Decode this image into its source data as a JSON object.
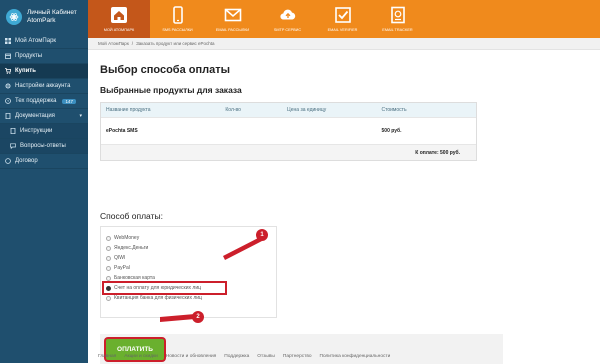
{
  "brand": {
    "line1": "Личный Кабинет",
    "line2": "AtomPark",
    "icon": "atom-icon"
  },
  "sidebar": {
    "items": [
      {
        "label": "Мой АтомПарк",
        "icon": "grid-icon"
      },
      {
        "label": "Продукты",
        "icon": "box-icon"
      },
      {
        "label": "Купить",
        "icon": "cart-icon",
        "active": true
      },
      {
        "label": "Настройки аккаунта",
        "icon": "gear-icon"
      },
      {
        "label": "Тех поддержка",
        "icon": "support-icon",
        "badge": "147"
      },
      {
        "label": "Документация",
        "icon": "doc-icon",
        "caret": "▾"
      },
      {
        "label": "Инструкции",
        "icon": "doc-icon",
        "sub": true
      },
      {
        "label": "Вопросы-ответы",
        "icon": "chat-icon",
        "sub": true
      },
      {
        "label": "Договор",
        "icon": "contract-icon"
      }
    ]
  },
  "topnav": [
    {
      "label": "Мой АтомПарк",
      "icon": "home-icon",
      "active": true
    },
    {
      "label": "SMS рассылки",
      "icon": "phone-icon"
    },
    {
      "label": "Email рассылки",
      "icon": "mail-icon"
    },
    {
      "label": "SMTP сервис",
      "icon": "cloud-upload-icon"
    },
    {
      "label": "Email verifier",
      "icon": "check-box-icon"
    },
    {
      "label": "Email tracker",
      "icon": "tracker-icon"
    }
  ],
  "breadcrumb": {
    "home": "Мой АтомПарк",
    "sep": "/",
    "current": "Заказать продукт или сервис ePochta"
  },
  "page": {
    "title": "Выбор способа оплаты",
    "subtitle": "Выбранные продукты для заказа"
  },
  "table": {
    "headers": [
      "Название продукта",
      "Кол-во",
      "Цена за единицу",
      "Стоимость"
    ],
    "row": {
      "name": "ePochta SMS",
      "qty": "",
      "price": "",
      "cost": "500 руб."
    },
    "total": "К оплате: 500 руб."
  },
  "payment": {
    "title": "Способ оплаты:",
    "options": [
      "WebMoney",
      "Яндекс.Деньги",
      "QIWI",
      "PayPal",
      "Банковская карта",
      "Счет на оплату для юридических лиц",
      "Квитанция банка для физических лиц"
    ],
    "selected_index": 5,
    "button": "Оплатить"
  },
  "markers": {
    "one": "1",
    "two": "2"
  },
  "footer": [
    "Главная",
    "Акции и скидки",
    "Новости и обновления",
    "Поддержка",
    "Отзывы",
    "Партнерство",
    "Политика конфиденциальности"
  ],
  "colors": {
    "sidebar": "#1f4f6e",
    "topbar": "#f08a1c",
    "topbar_active": "#c4571a",
    "accent_red": "#cc1f2b",
    "pay_green": "#6ab02e"
  }
}
